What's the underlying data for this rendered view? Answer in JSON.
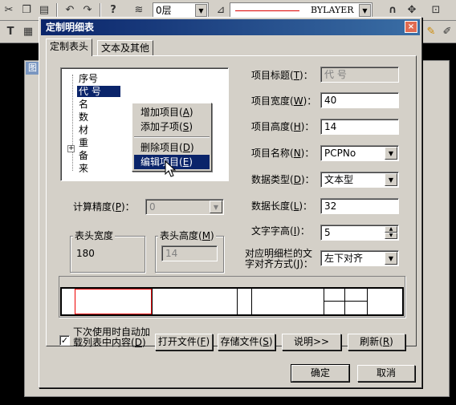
{
  "app": {
    "layer_combo": "0层",
    "linetype_text": "BYLAYER",
    "bg_window_title": "图"
  },
  "dialog": {
    "title": "定制明细表",
    "close_glyph": "×",
    "tabs": [
      {
        "label": "定制表头",
        "active": true
      },
      {
        "label": "文本及其他",
        "active": false
      }
    ],
    "tree": {
      "items": [
        "序号",
        "代    号",
        "名",
        "数",
        "材",
        "重",
        "备",
        "来"
      ],
      "expander": "+"
    },
    "context_menu": {
      "items": [
        {
          "label": "增加项目",
          "key": "A"
        },
        {
          "label": "添加子项",
          "key": "S"
        },
        {
          "label": "删除项目",
          "key": "D"
        },
        {
          "label": "编辑项目",
          "key": "E"
        }
      ]
    },
    "left": {
      "precision_label": "计算精度(",
      "precision_key": "P",
      "precision_value": "0",
      "header_width_title": "表头宽度",
      "header_width_value": "180",
      "header_height_title": "表头高度(",
      "header_height_key": "M",
      "header_height_value": "14"
    },
    "fields": [
      {
        "label": "项目标题(",
        "key": "T",
        "value": "代    号",
        "disabled": true,
        "type": "text"
      },
      {
        "label": "项目宽度(",
        "key": "W",
        "value": "40",
        "disabled": false,
        "type": "text"
      },
      {
        "label": "项目高度(",
        "key": "H",
        "value": "14",
        "disabled": false,
        "type": "text"
      },
      {
        "label": "项目名称(",
        "key": "N",
        "value": "PCPNo",
        "disabled": false,
        "type": "combo"
      },
      {
        "label": "数据类型(",
        "key": "D",
        "value": "文本型",
        "disabled": false,
        "type": "combo"
      },
      {
        "label": "数据长度(",
        "key": "L",
        "value": "32",
        "disabled": false,
        "type": "text"
      },
      {
        "label": "文字字高(",
        "key": "I",
        "value": "5",
        "disabled": false,
        "type": "spin"
      }
    ],
    "align": {
      "label_line1": "对应明细栏的文",
      "label_line2": "字对齐方式(",
      "key": "J",
      "value": "左下对齐"
    },
    "bottom": {
      "autoload_line1": "下次使用时自动加",
      "autoload_line2": "载列表中内容(",
      "autoload_key": "D",
      "autoload_checked": "✓",
      "open_file": "打开文件(",
      "open_key": "F",
      "save_file": "存储文件(",
      "save_key": "S",
      "explain": "说明>>",
      "refresh": "刷新(",
      "refresh_key": "R",
      "ok": "确定",
      "cancel": "取消"
    }
  }
}
